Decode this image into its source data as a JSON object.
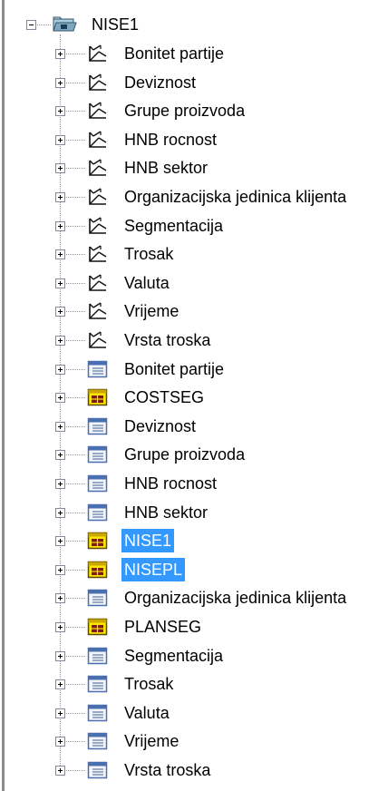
{
  "tree": {
    "root": {
      "label": "NISE1",
      "expanded": true,
      "icon": "folder-cube-icon"
    },
    "items": [
      {
        "label": "Bonitet partije",
        "icon": "dimension-icon"
      },
      {
        "label": "Deviznost",
        "icon": "dimension-icon"
      },
      {
        "label": "Grupe proizvoda",
        "icon": "dimension-icon"
      },
      {
        "label": "HNB rocnost",
        "icon": "dimension-icon"
      },
      {
        "label": "HNB sektor",
        "icon": "dimension-icon"
      },
      {
        "label": "Organizacijska jedinica klijenta",
        "icon": "dimension-icon"
      },
      {
        "label": "Segmentacija",
        "icon": "dimension-icon"
      },
      {
        "label": "Trosak",
        "icon": "dimension-icon"
      },
      {
        "label": "Valuta",
        "icon": "dimension-icon"
      },
      {
        "label": "Vrijeme",
        "icon": "dimension-icon"
      },
      {
        "label": "Vrsta troska",
        "icon": "dimension-icon"
      },
      {
        "label": "Bonitet partije",
        "icon": "table-icon"
      },
      {
        "label": "COSTSEG",
        "icon": "cube-table-icon"
      },
      {
        "label": "Deviznost",
        "icon": "table-icon"
      },
      {
        "label": "Grupe proizvoda",
        "icon": "table-icon"
      },
      {
        "label": "HNB rocnost",
        "icon": "table-icon"
      },
      {
        "label": "HNB sektor",
        "icon": "table-icon"
      },
      {
        "label": "NISE1",
        "icon": "cube-table-icon",
        "selected": true
      },
      {
        "label": "NISEPL",
        "icon": "cube-table-icon",
        "selected": true
      },
      {
        "label": "Organizacijska jedinica klijenta",
        "icon": "table-icon"
      },
      {
        "label": "PLANSEG",
        "icon": "cube-table-icon"
      },
      {
        "label": "Segmentacija",
        "icon": "table-icon"
      },
      {
        "label": "Trosak",
        "icon": "table-icon"
      },
      {
        "label": "Valuta",
        "icon": "table-icon"
      },
      {
        "label": "Vrijeme",
        "icon": "table-icon"
      },
      {
        "label": "Vrsta troska",
        "icon": "table-icon"
      }
    ]
  },
  "colors": {
    "selection_bg": "#3399ff",
    "selection_text": "#ffffff",
    "cube_yellow": "#ffe600",
    "table_blue": "#4a6fb0"
  }
}
